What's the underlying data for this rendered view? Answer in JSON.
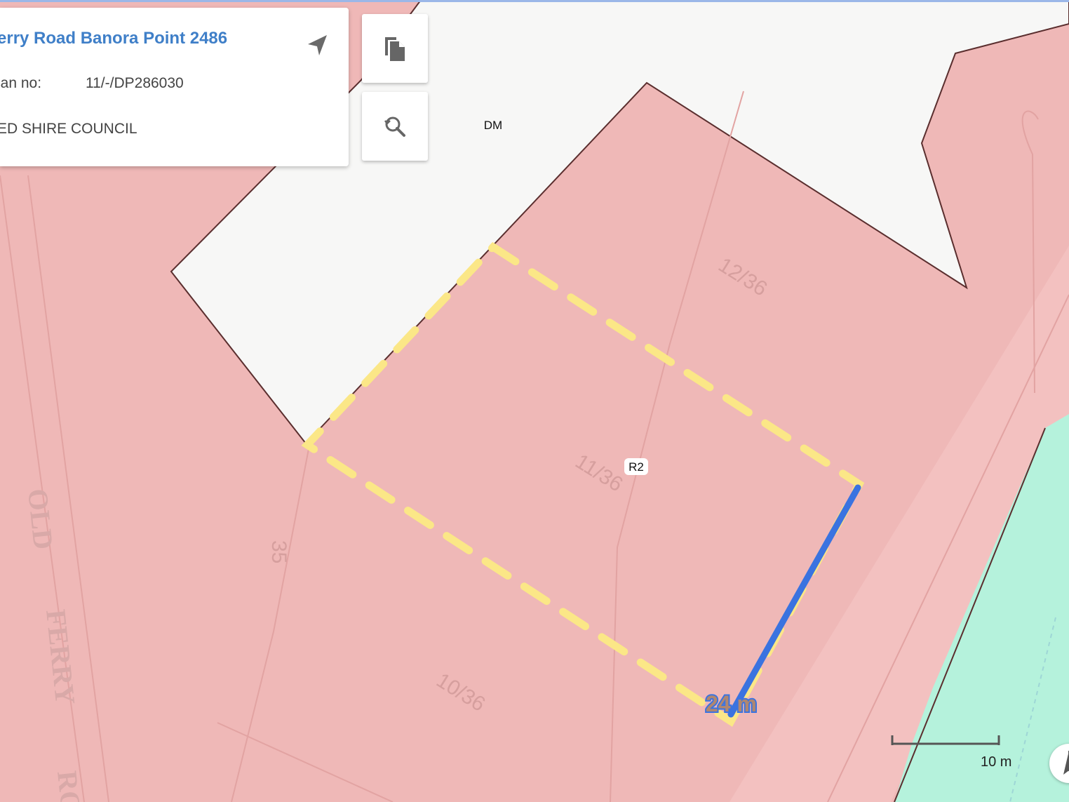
{
  "info_card": {
    "title": "erry Road Banora Point 2486",
    "plan_label": "lan no:",
    "plan_value": "11/-/DP286030",
    "council": "ED SHIRE COUNCIL"
  },
  "toolbar": {
    "copy_icon": "copy-icon",
    "zoom_icon": "zoom-reset-icon"
  },
  "map": {
    "zone_labels": [
      "DM",
      "R2"
    ],
    "lot_labels": [
      "12/36",
      "11/36",
      "10/36",
      "35"
    ],
    "street_words": [
      "OLD",
      "FERRY",
      "RO"
    ],
    "measurement": {
      "label": "24 m",
      "value": 24,
      "unit": "m"
    },
    "scale_bar": {
      "label": "10 m"
    },
    "colors": {
      "residential_zone": "#efb8b7",
      "residential_zone_light": "#f3c1c0",
      "unzoned_area": "#f7f7f6",
      "recreation_zone": "#b5f2dc",
      "boundary_line": "#5a2e2e",
      "selection_dash": "#fbe787",
      "measure_line": "#3a73e0"
    }
  }
}
